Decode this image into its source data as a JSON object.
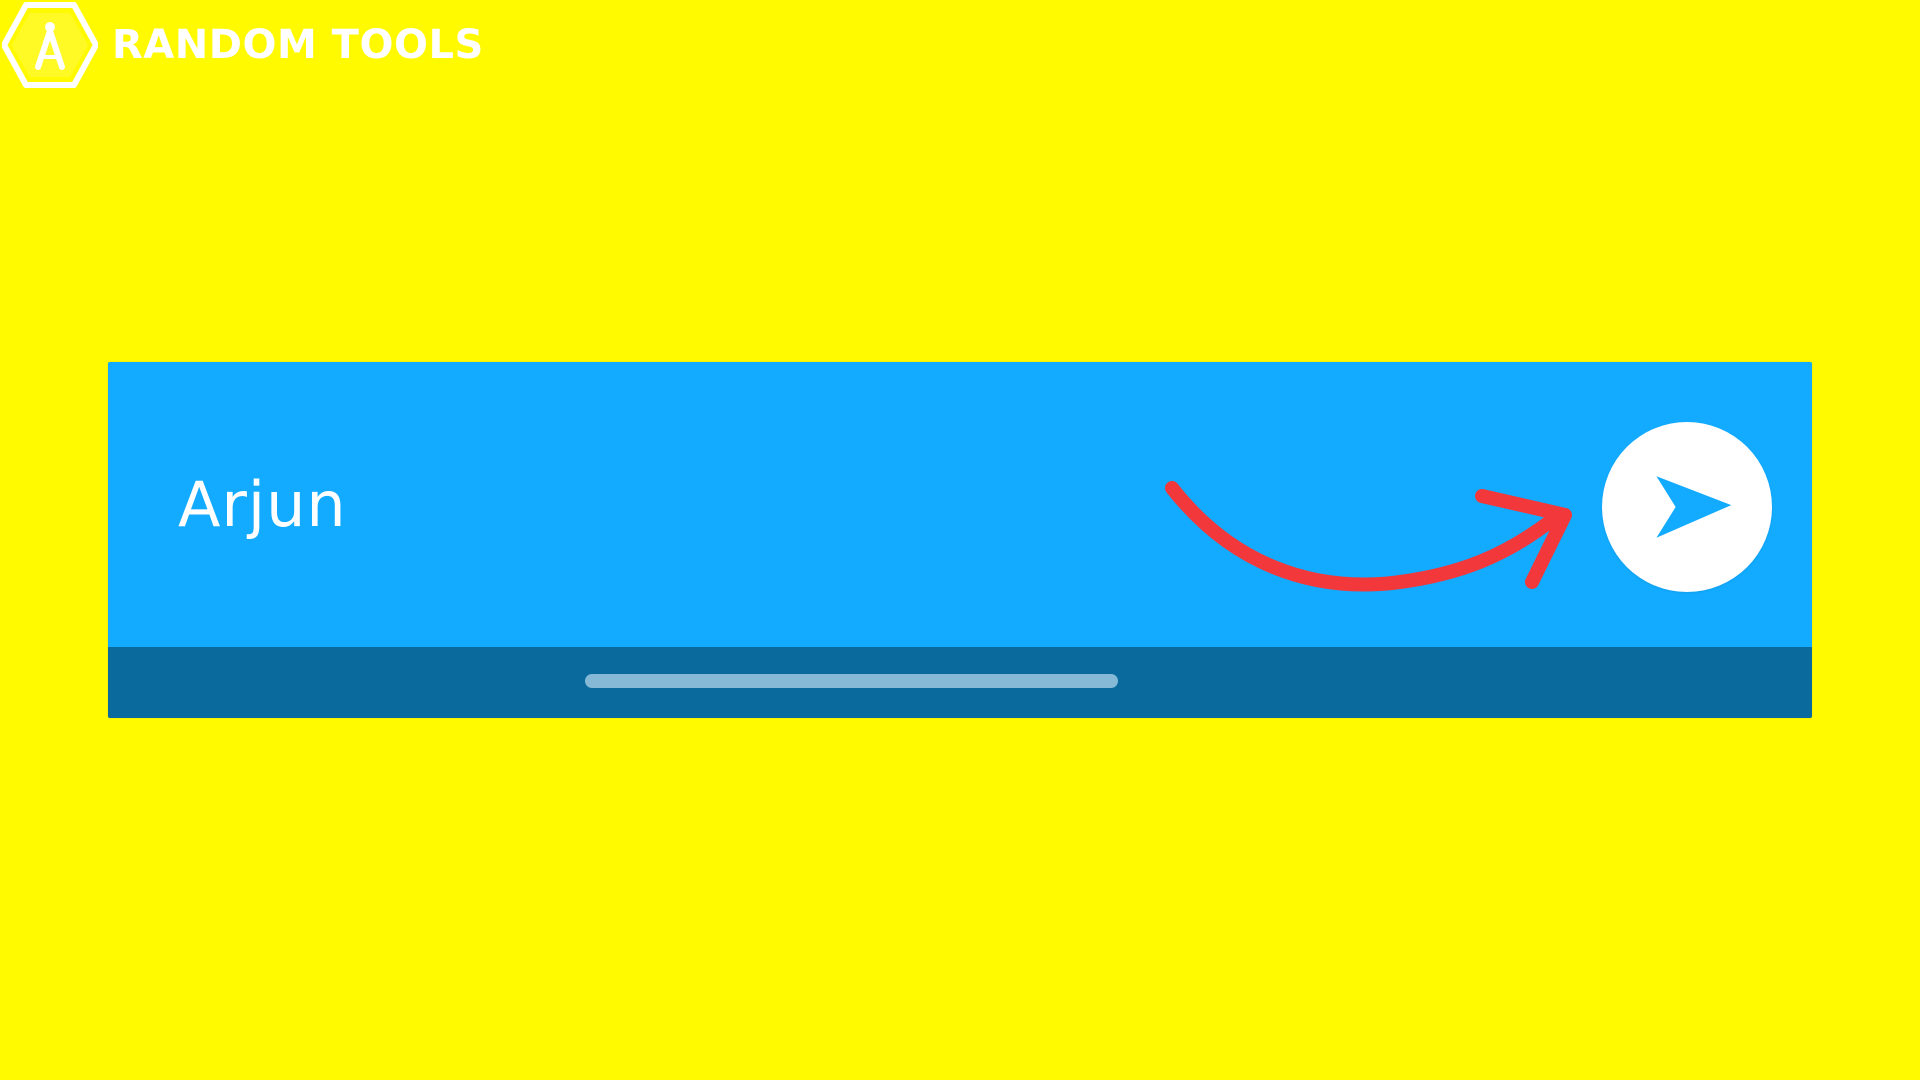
{
  "brand": {
    "name": "RANDOM TOOLS",
    "logo_icon": "compass-hexagon-icon"
  },
  "chat": {
    "input_text": "Arjun",
    "send_icon": "send-arrow-icon"
  },
  "annotation": {
    "arrow_icon": "curved-arrow-icon"
  },
  "colors": {
    "background": "#FFFA00",
    "input_bar": "#12ABFF",
    "bottom_bar": "#0A6A9E",
    "home_indicator": "#86B9D6",
    "send_button": "#FFFFFF",
    "send_icon": "#12ABFF",
    "annotation_arrow": "#F2383A",
    "brand_text": "#FFFFFF"
  }
}
